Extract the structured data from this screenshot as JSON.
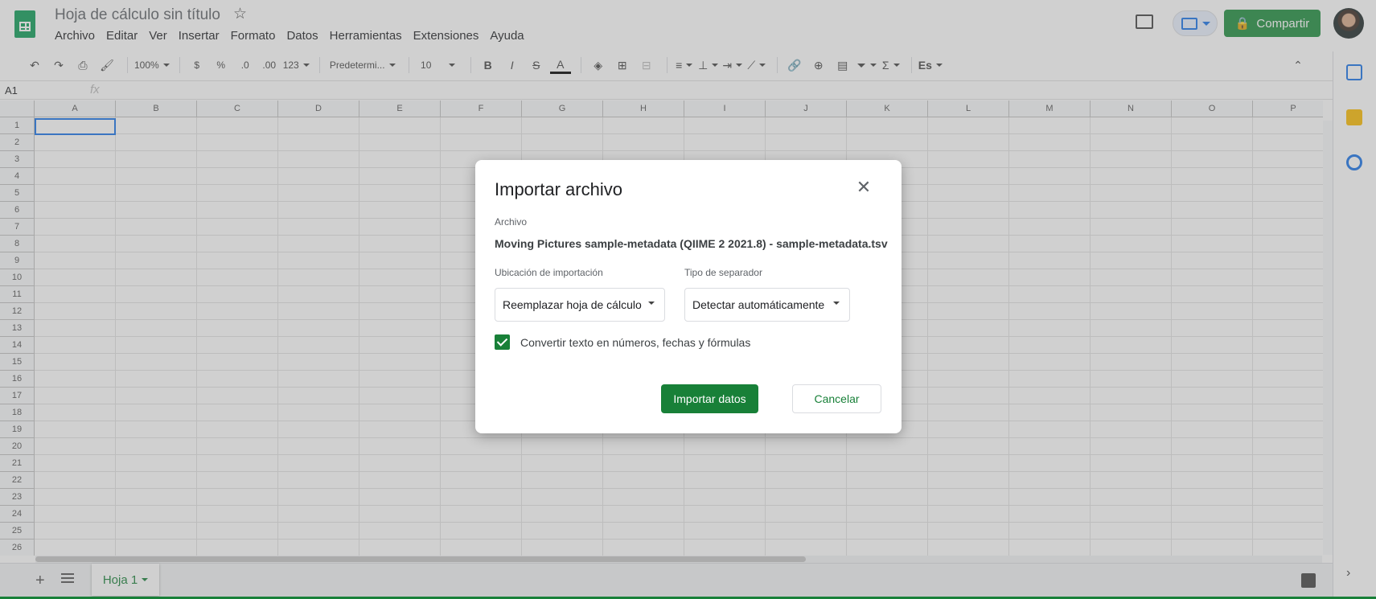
{
  "app": {
    "doc_title": "Hoja de cálculo sin título",
    "menu": [
      "Archivo",
      "Editar",
      "Ver",
      "Insertar",
      "Formato",
      "Datos",
      "Herramientas",
      "Extensiones",
      "Ayuda"
    ],
    "share_label": "Compartir"
  },
  "toolbar": {
    "zoom": "100%",
    "currency": "$",
    "percent": "%",
    "dec_decrease": ".0",
    "dec_increase": ".00",
    "number_format": "123",
    "font": "Predetermi...",
    "font_size": "10",
    "bold": "B",
    "italic": "I",
    "strike": "S",
    "text_color": "A",
    "input_tools": "Es"
  },
  "formula_bar": {
    "name_box": "A1",
    "fx": "fx"
  },
  "grid": {
    "columns": [
      "A",
      "B",
      "C",
      "D",
      "E",
      "F",
      "G",
      "H",
      "I",
      "J",
      "K",
      "L",
      "M",
      "N",
      "O",
      "P"
    ],
    "rows": [
      "1",
      "2",
      "3",
      "4",
      "5",
      "6",
      "7",
      "8",
      "9",
      "10",
      "11",
      "12",
      "13",
      "14",
      "15",
      "16",
      "17",
      "18",
      "19",
      "20",
      "21",
      "22",
      "23",
      "24",
      "25",
      "26"
    ]
  },
  "sheets": {
    "add": "+",
    "active_tab": "Hoja 1"
  },
  "dialog": {
    "title": "Importar archivo",
    "close": "✕",
    "file_label": "Archivo",
    "file_name": "Moving Pictures sample-metadata (QIIME 2 2021.8) - sample-metadata.tsv",
    "location_label": "Ubicación de importación",
    "location_value": "Reemplazar hoja de cálculo",
    "separator_label": "Tipo de separador",
    "separator_value": "Detectar automáticamente",
    "convert_label": "Convertir texto en números, fechas y fórmulas",
    "convert_checked": true,
    "import_button": "Importar datos",
    "cancel_button": "Cancelar"
  },
  "colors": {
    "accent_green": "#188038",
    "selection_blue": "#1a73e8"
  }
}
